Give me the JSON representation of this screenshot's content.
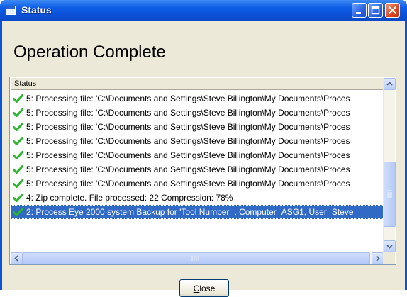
{
  "window": {
    "title": "Status"
  },
  "heading": "Operation Complete",
  "list": {
    "column_header": "Status",
    "rows": [
      {
        "text": "5: Processing file: 'C:\\Documents and Settings\\Steve Billington\\My Documents\\Proces",
        "icon": "check-icon",
        "selected": false
      },
      {
        "text": "5: Processing file: 'C:\\Documents and Settings\\Steve Billington\\My Documents\\Proces",
        "icon": "check-icon",
        "selected": false
      },
      {
        "text": "5: Processing file: 'C:\\Documents and Settings\\Steve Billington\\My Documents\\Proces",
        "icon": "check-icon",
        "selected": false
      },
      {
        "text": "5: Processing file: 'C:\\Documents and Settings\\Steve Billington\\My Documents\\Proces",
        "icon": "check-icon",
        "selected": false
      },
      {
        "text": "5: Processing file: 'C:\\Documents and Settings\\Steve Billington\\My Documents\\Proces",
        "icon": "check-icon",
        "selected": false
      },
      {
        "text": "5: Processing file: 'C:\\Documents and Settings\\Steve Billington\\My Documents\\Proces",
        "icon": "check-icon",
        "selected": false
      },
      {
        "text": "5: Processing file: 'C:\\Documents and Settings\\Steve Billington\\My Documents\\Proces",
        "icon": "check-icon",
        "selected": false
      },
      {
        "text": "4: Zip complete. File processed: 22 Compression: 78%",
        "icon": "check-icon",
        "selected": false
      },
      {
        "text": "2: Process Eye 2000 system Backup for 'Tool Number=, Computer=ASG1, User=Steve",
        "icon": "check-icon",
        "selected": true
      }
    ]
  },
  "buttons": {
    "close_label": "Close"
  },
  "colors": {
    "titlebar": "#0a52d8",
    "selection": "#316ac5",
    "check": "#2db52d",
    "close_button": "#d9461f"
  }
}
